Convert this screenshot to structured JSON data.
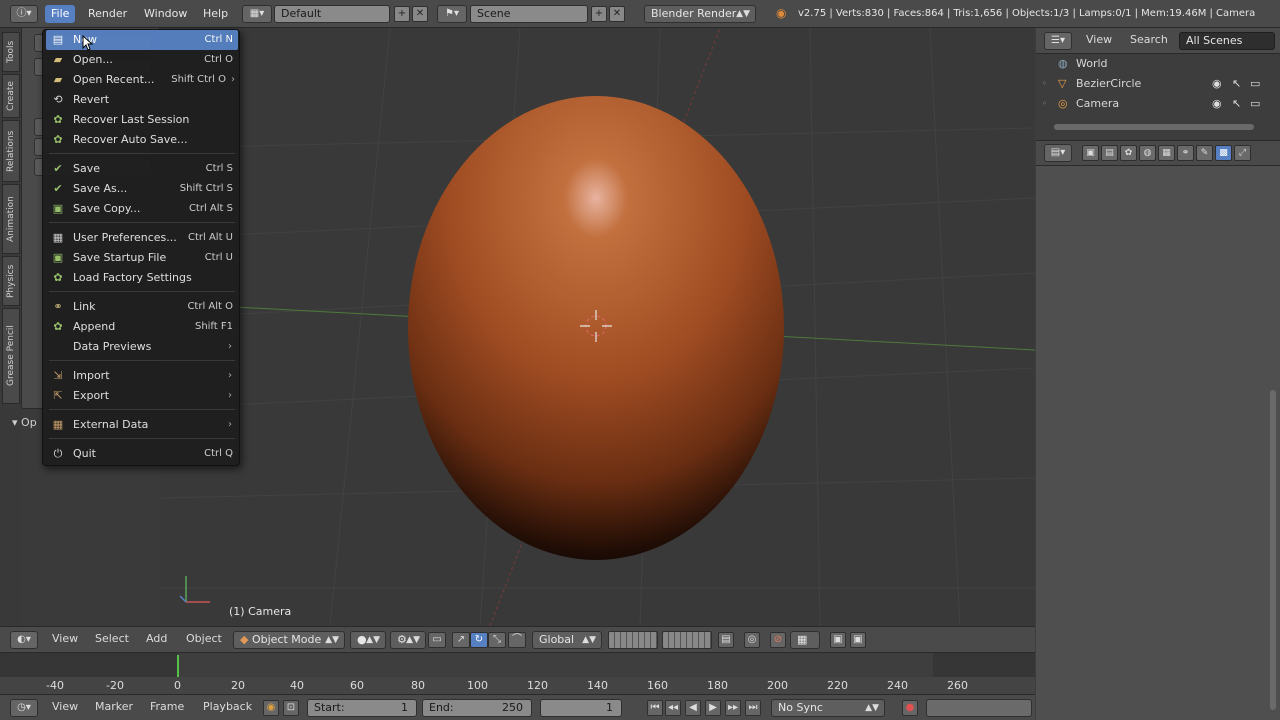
{
  "header": {
    "menus": [
      "File",
      "Render",
      "Window",
      "Help"
    ],
    "active_menu": "File",
    "screen_layout": "Default",
    "scene": "Scene",
    "render_engine": "Blender Render",
    "stats": "v2.75 | Verts:830 | Faces:864 | Tris:1,656 | Objects:1/3 | Lamps:0/1 | Mem:19.46M | Camera"
  },
  "left_tabs": [
    "Tools",
    "Create",
    "Relations",
    "Animation",
    "Physics",
    "Grease Pencil"
  ],
  "tool_shelf": {
    "operator_label": "Op"
  },
  "file_menu": {
    "items": [
      {
        "label": "New",
        "shortcut": "Ctrl N",
        "icon": "new-file-icon",
        "highlighted": true
      },
      {
        "label": "Open...",
        "shortcut": "Ctrl O",
        "icon": "folder-open-icon"
      },
      {
        "label": "Open Recent...",
        "shortcut": "Shift Ctrl O",
        "icon": "folder-recent-icon",
        "submenu": true
      },
      {
        "label": "Revert",
        "shortcut": "",
        "icon": "revert-icon"
      },
      {
        "label": "Recover Last Session",
        "shortcut": "",
        "icon": "recover-icon"
      },
      {
        "label": "Recover Auto Save...",
        "shortcut": "",
        "icon": "recover-auto-icon"
      },
      {
        "label": "Save",
        "shortcut": "Ctrl S",
        "icon": "check-icon"
      },
      {
        "label": "Save As...",
        "shortcut": "Shift Ctrl S",
        "icon": "check-icon"
      },
      {
        "label": "Save Copy...",
        "shortcut": "Ctrl Alt S",
        "icon": "save-copy-icon"
      },
      {
        "label": "User Preferences...",
        "shortcut": "Ctrl Alt U",
        "icon": "preferences-icon"
      },
      {
        "label": "Save Startup File",
        "shortcut": "Ctrl U",
        "icon": "save-startup-icon"
      },
      {
        "label": "Load Factory Settings",
        "shortcut": "",
        "icon": "load-factory-icon"
      },
      {
        "label": "Link",
        "shortcut": "Ctrl Alt O",
        "icon": "link-icon"
      },
      {
        "label": "Append",
        "shortcut": "Shift F1",
        "icon": "append-icon"
      },
      {
        "label": "Data Previews",
        "shortcut": "",
        "icon": "",
        "submenu": true
      },
      {
        "label": "Import",
        "shortcut": "",
        "icon": "import-icon",
        "submenu": true
      },
      {
        "label": "Export",
        "shortcut": "",
        "icon": "export-icon",
        "submenu": true
      },
      {
        "label": "External Data",
        "shortcut": "",
        "icon": "external-data-icon",
        "submenu": true
      },
      {
        "label": "Quit",
        "shortcut": "Ctrl Q",
        "icon": "power-icon"
      }
    ]
  },
  "viewport": {
    "object_label": "(1) Camera"
  },
  "viewport_header": {
    "menus": [
      "View",
      "Select",
      "Add",
      "Object"
    ],
    "mode": "Object Mode",
    "orientation": "Global"
  },
  "timeline": {
    "ticks": [
      "-40",
      "-20",
      "0",
      "20",
      "40",
      "60",
      "80",
      "100",
      "120",
      "140",
      "160",
      "180",
      "200",
      "220",
      "240",
      "260"
    ],
    "current_frame_marker": "0"
  },
  "timeline_footer": {
    "menus": [
      "View",
      "Marker",
      "Frame",
      "Playback"
    ],
    "start_label": "Start:",
    "start_value": "1",
    "end_label": "End:",
    "end_value": "250",
    "current_frame": "1",
    "sync": "No Sync"
  },
  "outliner": {
    "tabs": [
      "View",
      "Search",
      "All Scenes"
    ],
    "rows": [
      {
        "name": "World",
        "icon": "world-icon"
      },
      {
        "name": "BezierCircle",
        "icon": "curve-icon"
      },
      {
        "name": "Camera",
        "icon": "camera-icon"
      }
    ]
  },
  "colors": {
    "accent": "#5680c2",
    "egg": "#a0522d",
    "panel": "#4a4a4a",
    "viewport": "#393939"
  }
}
